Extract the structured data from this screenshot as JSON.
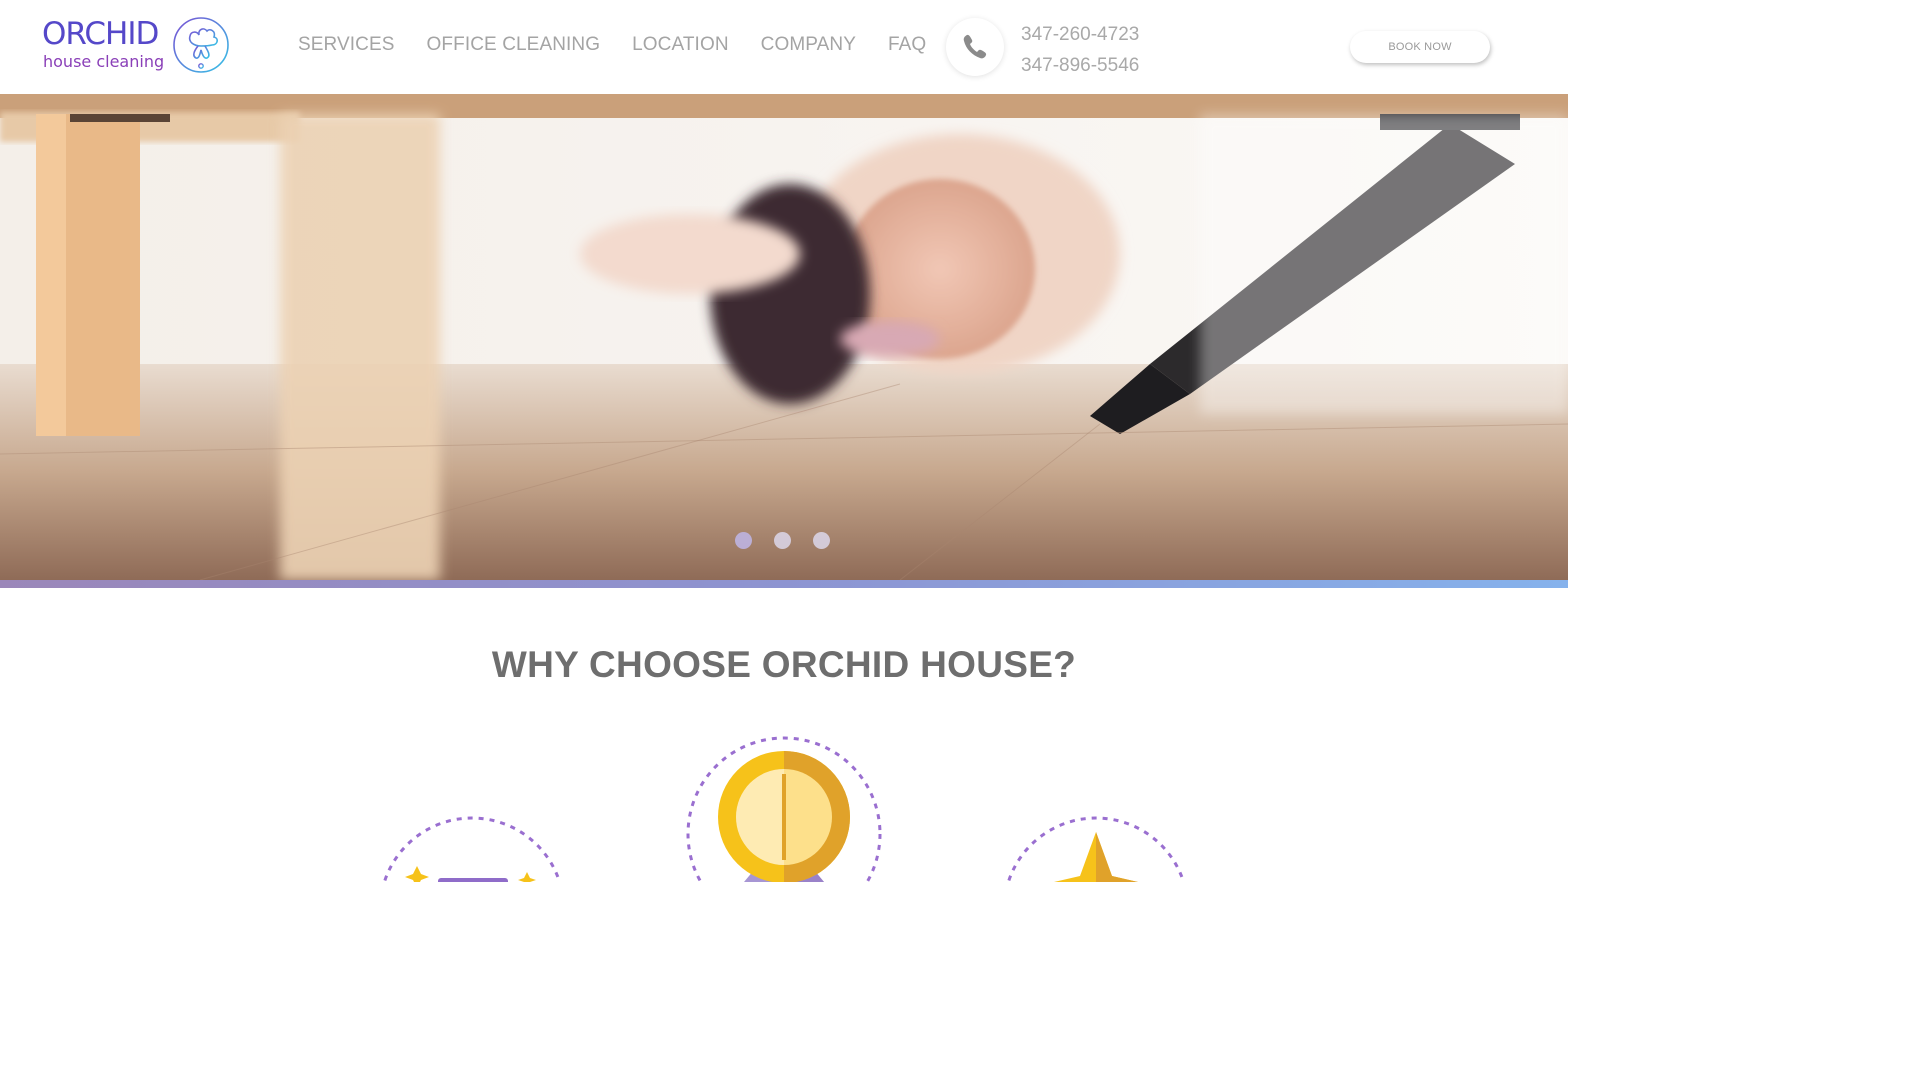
{
  "brand": {
    "name": "ORCHID",
    "tagline": "house cleaning"
  },
  "nav": {
    "items": [
      {
        "label": "SERVICES"
      },
      {
        "label": "OFFICE CLEANING"
      },
      {
        "label": "LOCATION"
      },
      {
        "label": "COMPANY"
      },
      {
        "label": "FAQ"
      }
    ]
  },
  "contact": {
    "phone_icon": "phone-icon",
    "phone_1": "347-260-4723",
    "phone_2": "347-896-5546"
  },
  "header": {
    "book_label": "BOOK NOW"
  },
  "hero": {
    "slide_count": 3,
    "active_slide": 1
  },
  "section": {
    "title": "WHY CHOOSE ORCHID HOUSE?"
  },
  "colors": {
    "brand_blue": "#5548c9",
    "brand_purple": "#8a3fb8",
    "nav_text": "#a4a4a4",
    "accent_gradient_start": "#9b87b9",
    "accent_gradient_end": "#86b2ec",
    "dashed_circle": "#9a6fd0",
    "gold": "#f6c21a"
  }
}
